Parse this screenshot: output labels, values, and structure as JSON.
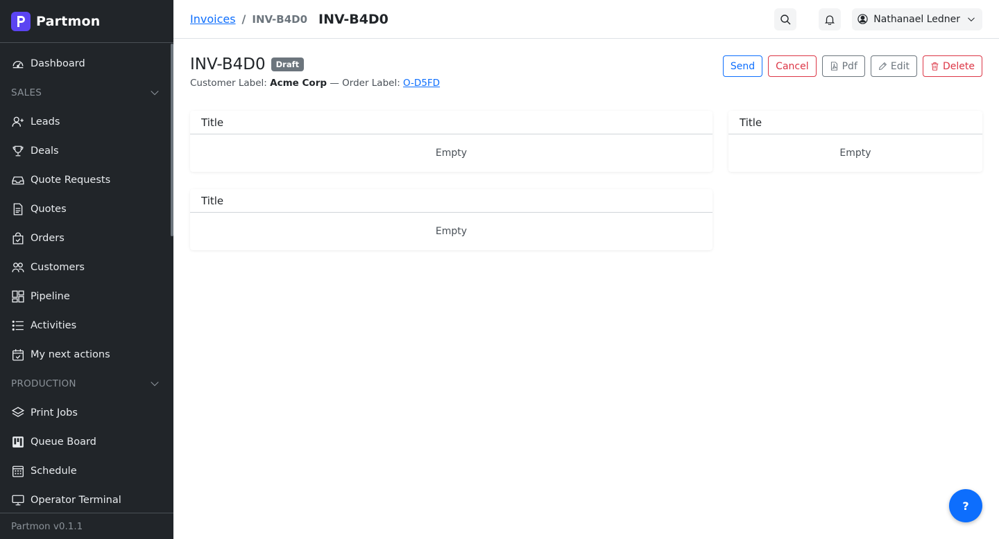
{
  "brand": {
    "name": "Partmon",
    "color": "#5b44f2"
  },
  "sidebar": {
    "dashboard": {
      "label": "Dashboard",
      "icon": "gauge-icon"
    },
    "sales_section": "SALES",
    "sales_items": [
      {
        "label": "Leads",
        "icon": "user-plus-icon"
      },
      {
        "label": "Deals",
        "icon": "trophy-icon"
      },
      {
        "label": "Quote Requests",
        "icon": "inbox-icon"
      },
      {
        "label": "Quotes",
        "icon": "document-icon"
      },
      {
        "label": "Orders",
        "icon": "bag-check-icon"
      },
      {
        "label": "Customers",
        "icon": "people-icon"
      },
      {
        "label": "Pipeline",
        "icon": "kanban-icon"
      },
      {
        "label": "Activities",
        "icon": "list-icon"
      },
      {
        "label": "My next actions",
        "icon": "calendar-check-icon"
      }
    ],
    "production_section": "PRODUCTION",
    "production_items": [
      {
        "label": "Print Jobs",
        "icon": "layers-icon"
      },
      {
        "label": "Queue Board",
        "icon": "board-icon"
      },
      {
        "label": "Schedule",
        "icon": "calendar-grid-icon"
      },
      {
        "label": "Operator Terminal",
        "icon": "monitor-icon"
      }
    ],
    "footer": "Partmon v0.1.1"
  },
  "topbar": {
    "breadcrumb_link": "Invoices",
    "breadcrumb_sep": "/",
    "breadcrumb_current": "INV-B4D0",
    "title": "INV-B4D0",
    "user_name": "Nathanael Ledner"
  },
  "page": {
    "title": "INV-B4D0",
    "badge": "Draft",
    "customer_label_prefix": "Customer Label:",
    "customer_label": "Acme Corp",
    "separator": "—",
    "order_label_prefix": "Order Label:",
    "order_label": "O-D5FD"
  },
  "actions": {
    "send": "Send",
    "cancel": "Cancel",
    "pdf": "Pdf",
    "edit": "Edit",
    "delete": "Delete"
  },
  "cards": [
    {
      "title": "Title",
      "body": "Empty"
    },
    {
      "title": "Title",
      "body": "Empty"
    },
    {
      "title": "Title",
      "body": "Empty"
    }
  ],
  "help": {
    "label": "?"
  },
  "colors": {
    "primary": "#0d6efd",
    "danger": "#dc3545",
    "secondary": "#6c757d",
    "sidebar_bg": "#212529"
  }
}
